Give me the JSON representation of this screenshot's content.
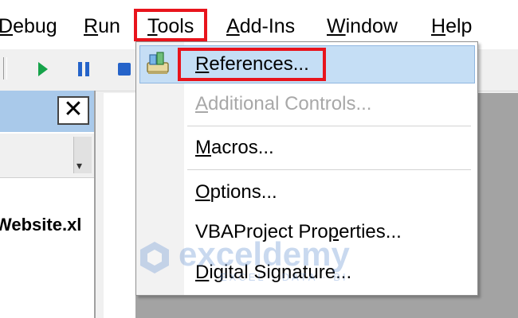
{
  "menubar": {
    "items": [
      {
        "label": "Debug",
        "accel_index": 0
      },
      {
        "label": "Run",
        "accel_index": 0
      },
      {
        "label": "Tools",
        "accel_index": 0
      },
      {
        "label": "Add-Ins",
        "accel_index": 0
      },
      {
        "label": "Window",
        "accel_index": 0
      },
      {
        "label": "Help",
        "accel_index": 0
      }
    ],
    "highlighted": "Tools",
    "highlight_color": "#e8141c"
  },
  "toolbar": {
    "icons": [
      "run-icon",
      "break-icon",
      "reset-icon"
    ],
    "colors": {
      "run": "#16a34a",
      "break": "#2563c9",
      "reset": "#2563c9"
    }
  },
  "project_pane": {
    "close_label": "✕",
    "project_text": "Website.xl",
    "title_color": "#a9c9ea"
  },
  "tools_menu": {
    "items": [
      {
        "label": "References...",
        "enabled": true,
        "selected": true,
        "icon": "references-icon"
      },
      {
        "label": "Additional Controls...",
        "enabled": false
      },
      {
        "label": "Macros...",
        "enabled": true
      },
      {
        "label": "Options...",
        "enabled": true
      },
      {
        "label": "VBAProject Properties...",
        "enabled": true
      },
      {
        "label": "Digital Signature...",
        "enabled": true
      }
    ],
    "selected_color": "#c5def5"
  },
  "watermark": {
    "brand": "exceldemy",
    "tagline": "EXCEL · DATA · BI"
  }
}
